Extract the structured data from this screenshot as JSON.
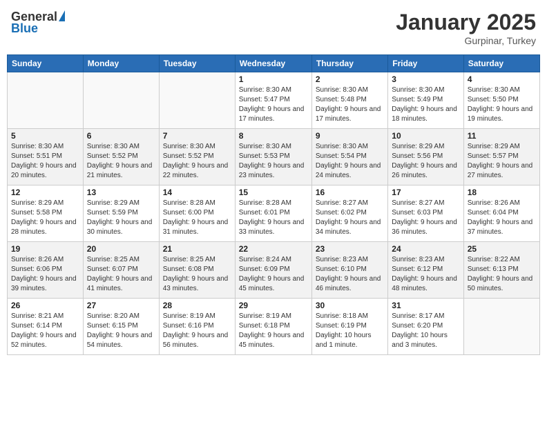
{
  "header": {
    "logo_general": "General",
    "logo_blue": "Blue",
    "month": "January 2025",
    "location": "Gurpinar, Turkey"
  },
  "weekdays": [
    "Sunday",
    "Monday",
    "Tuesday",
    "Wednesday",
    "Thursday",
    "Friday",
    "Saturday"
  ],
  "weeks": [
    [
      {
        "day": "",
        "sunrise": "",
        "sunset": "",
        "daylight": ""
      },
      {
        "day": "",
        "sunrise": "",
        "sunset": "",
        "daylight": ""
      },
      {
        "day": "",
        "sunrise": "",
        "sunset": "",
        "daylight": ""
      },
      {
        "day": "1",
        "sunrise": "Sunrise: 8:30 AM",
        "sunset": "Sunset: 5:47 PM",
        "daylight": "Daylight: 9 hours and 17 minutes."
      },
      {
        "day": "2",
        "sunrise": "Sunrise: 8:30 AM",
        "sunset": "Sunset: 5:48 PM",
        "daylight": "Daylight: 9 hours and 17 minutes."
      },
      {
        "day": "3",
        "sunrise": "Sunrise: 8:30 AM",
        "sunset": "Sunset: 5:49 PM",
        "daylight": "Daylight: 9 hours and 18 minutes."
      },
      {
        "day": "4",
        "sunrise": "Sunrise: 8:30 AM",
        "sunset": "Sunset: 5:50 PM",
        "daylight": "Daylight: 9 hours and 19 minutes."
      }
    ],
    [
      {
        "day": "5",
        "sunrise": "Sunrise: 8:30 AM",
        "sunset": "Sunset: 5:51 PM",
        "daylight": "Daylight: 9 hours and 20 minutes."
      },
      {
        "day": "6",
        "sunrise": "Sunrise: 8:30 AM",
        "sunset": "Sunset: 5:52 PM",
        "daylight": "Daylight: 9 hours and 21 minutes."
      },
      {
        "day": "7",
        "sunrise": "Sunrise: 8:30 AM",
        "sunset": "Sunset: 5:52 PM",
        "daylight": "Daylight: 9 hours and 22 minutes."
      },
      {
        "day": "8",
        "sunrise": "Sunrise: 8:30 AM",
        "sunset": "Sunset: 5:53 PM",
        "daylight": "Daylight: 9 hours and 23 minutes."
      },
      {
        "day": "9",
        "sunrise": "Sunrise: 8:30 AM",
        "sunset": "Sunset: 5:54 PM",
        "daylight": "Daylight: 9 hours and 24 minutes."
      },
      {
        "day": "10",
        "sunrise": "Sunrise: 8:29 AM",
        "sunset": "Sunset: 5:56 PM",
        "daylight": "Daylight: 9 hours and 26 minutes."
      },
      {
        "day": "11",
        "sunrise": "Sunrise: 8:29 AM",
        "sunset": "Sunset: 5:57 PM",
        "daylight": "Daylight: 9 hours and 27 minutes."
      }
    ],
    [
      {
        "day": "12",
        "sunrise": "Sunrise: 8:29 AM",
        "sunset": "Sunset: 5:58 PM",
        "daylight": "Daylight: 9 hours and 28 minutes."
      },
      {
        "day": "13",
        "sunrise": "Sunrise: 8:29 AM",
        "sunset": "Sunset: 5:59 PM",
        "daylight": "Daylight: 9 hours and 30 minutes."
      },
      {
        "day": "14",
        "sunrise": "Sunrise: 8:28 AM",
        "sunset": "Sunset: 6:00 PM",
        "daylight": "Daylight: 9 hours and 31 minutes."
      },
      {
        "day": "15",
        "sunrise": "Sunrise: 8:28 AM",
        "sunset": "Sunset: 6:01 PM",
        "daylight": "Daylight: 9 hours and 33 minutes."
      },
      {
        "day": "16",
        "sunrise": "Sunrise: 8:27 AM",
        "sunset": "Sunset: 6:02 PM",
        "daylight": "Daylight: 9 hours and 34 minutes."
      },
      {
        "day": "17",
        "sunrise": "Sunrise: 8:27 AM",
        "sunset": "Sunset: 6:03 PM",
        "daylight": "Daylight: 9 hours and 36 minutes."
      },
      {
        "day": "18",
        "sunrise": "Sunrise: 8:26 AM",
        "sunset": "Sunset: 6:04 PM",
        "daylight": "Daylight: 9 hours and 37 minutes."
      }
    ],
    [
      {
        "day": "19",
        "sunrise": "Sunrise: 8:26 AM",
        "sunset": "Sunset: 6:06 PM",
        "daylight": "Daylight: 9 hours and 39 minutes."
      },
      {
        "day": "20",
        "sunrise": "Sunrise: 8:25 AM",
        "sunset": "Sunset: 6:07 PM",
        "daylight": "Daylight: 9 hours and 41 minutes."
      },
      {
        "day": "21",
        "sunrise": "Sunrise: 8:25 AM",
        "sunset": "Sunset: 6:08 PM",
        "daylight": "Daylight: 9 hours and 43 minutes."
      },
      {
        "day": "22",
        "sunrise": "Sunrise: 8:24 AM",
        "sunset": "Sunset: 6:09 PM",
        "daylight": "Daylight: 9 hours and 45 minutes."
      },
      {
        "day": "23",
        "sunrise": "Sunrise: 8:23 AM",
        "sunset": "Sunset: 6:10 PM",
        "daylight": "Daylight: 9 hours and 46 minutes."
      },
      {
        "day": "24",
        "sunrise": "Sunrise: 8:23 AM",
        "sunset": "Sunset: 6:12 PM",
        "daylight": "Daylight: 9 hours and 48 minutes."
      },
      {
        "day": "25",
        "sunrise": "Sunrise: 8:22 AM",
        "sunset": "Sunset: 6:13 PM",
        "daylight": "Daylight: 9 hours and 50 minutes."
      }
    ],
    [
      {
        "day": "26",
        "sunrise": "Sunrise: 8:21 AM",
        "sunset": "Sunset: 6:14 PM",
        "daylight": "Daylight: 9 hours and 52 minutes."
      },
      {
        "day": "27",
        "sunrise": "Sunrise: 8:20 AM",
        "sunset": "Sunset: 6:15 PM",
        "daylight": "Daylight: 9 hours and 54 minutes."
      },
      {
        "day": "28",
        "sunrise": "Sunrise: 8:19 AM",
        "sunset": "Sunset: 6:16 PM",
        "daylight": "Daylight: 9 hours and 56 minutes."
      },
      {
        "day": "29",
        "sunrise": "Sunrise: 8:19 AM",
        "sunset": "Sunset: 6:18 PM",
        "daylight": "Daylight: 9 hours and 45 minutes."
      },
      {
        "day": "30",
        "sunrise": "Sunrise: 8:18 AM",
        "sunset": "Sunset: 6:19 PM",
        "daylight": "Daylight: 10 hours and 1 minute."
      },
      {
        "day": "31",
        "sunrise": "Sunrise: 8:17 AM",
        "sunset": "Sunset: 6:20 PM",
        "daylight": "Daylight: 10 hours and 3 minutes."
      },
      {
        "day": "",
        "sunrise": "",
        "sunset": "",
        "daylight": ""
      }
    ]
  ]
}
